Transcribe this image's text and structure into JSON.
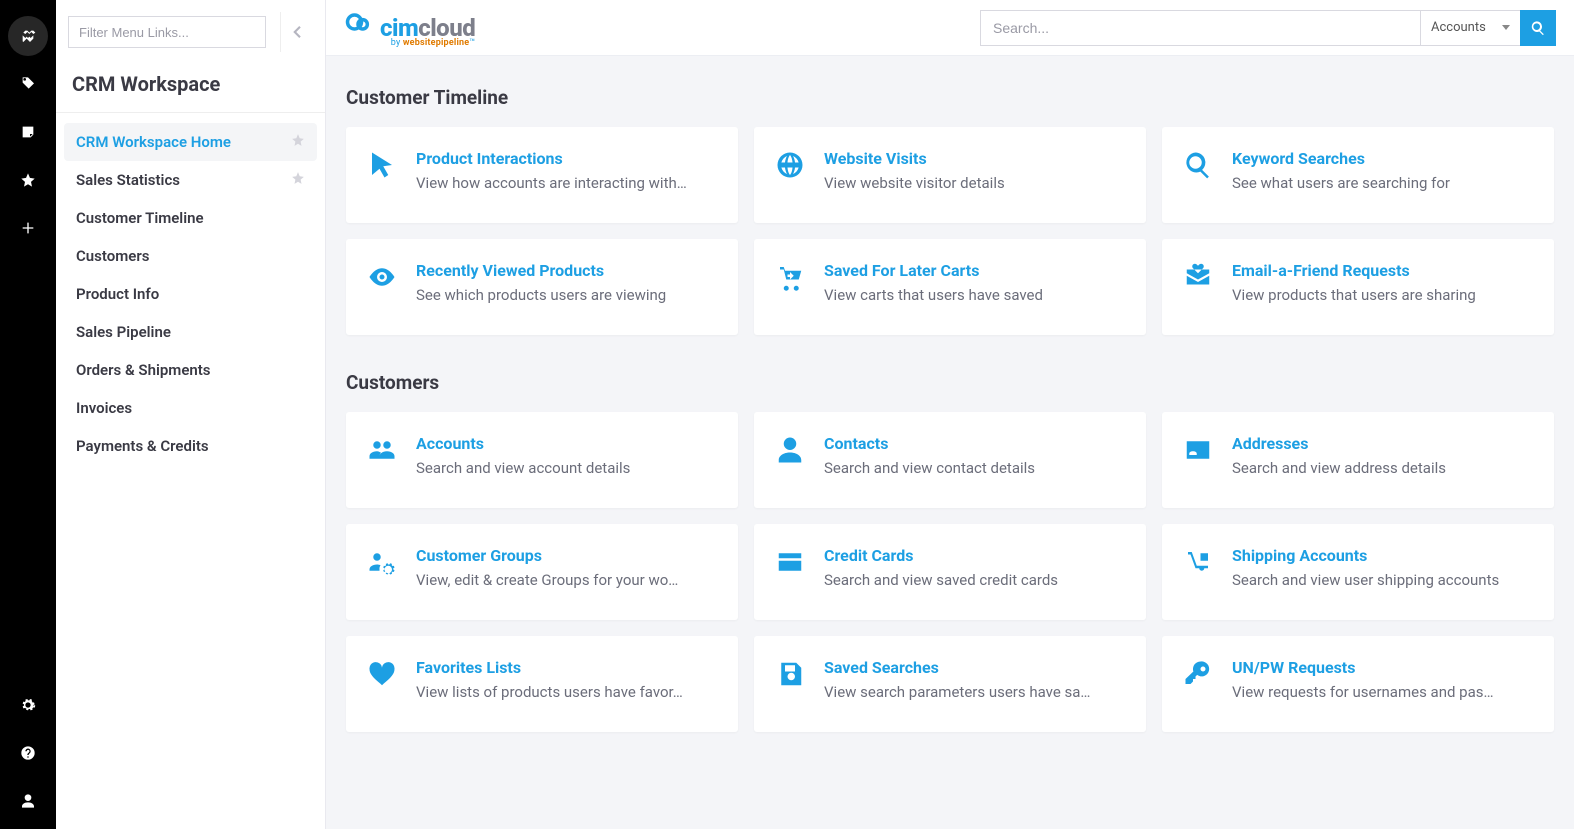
{
  "rail": {
    "items": [
      {
        "name": "handshake-icon",
        "active": true
      },
      {
        "name": "tag-icon"
      },
      {
        "name": "note-icon"
      },
      {
        "name": "star-icon"
      },
      {
        "name": "plus-icon"
      }
    ],
    "bottom": [
      {
        "name": "gear-icon"
      },
      {
        "name": "help-icon"
      },
      {
        "name": "user-icon"
      }
    ]
  },
  "sidebar": {
    "filter_placeholder": "Filter Menu Links...",
    "title": "CRM Workspace",
    "items": [
      {
        "label": "CRM Workspace Home",
        "active": true,
        "starred": false,
        "show_star": true
      },
      {
        "label": "Sales Statistics",
        "starred": false,
        "show_star": true
      },
      {
        "label": "Customer Timeline"
      },
      {
        "label": "Customers"
      },
      {
        "label": "Product Info"
      },
      {
        "label": "Sales Pipeline"
      },
      {
        "label": "Orders & Shipments"
      },
      {
        "label": "Invoices"
      },
      {
        "label": "Payments & Credits"
      }
    ]
  },
  "topbar": {
    "logo_main_1": "cim",
    "logo_main_2": "cloud",
    "logo_sub_prefix": "by ",
    "logo_sub_brand": "websitepipeline",
    "search_placeholder": "Search...",
    "search_scope": "Accounts"
  },
  "sections": [
    {
      "title": "Customer Timeline",
      "cards": [
        {
          "icon": "cursor-icon",
          "title": "Product Interactions",
          "desc": "View how accounts are interacting with…"
        },
        {
          "icon": "globe-icon",
          "title": "Website Visits",
          "desc": "View website visitor details"
        },
        {
          "icon": "search-icon",
          "title": "Keyword Searches",
          "desc": "See what users are searching for"
        },
        {
          "icon": "eye-icon",
          "title": "Recently Viewed Products",
          "desc": "See which products users are viewing"
        },
        {
          "icon": "cart-down-icon",
          "title": "Saved For Later Carts",
          "desc": "View carts that users have saved"
        },
        {
          "icon": "mail-heart-icon",
          "title": "Email-a-Friend Requests",
          "desc": "View products that users are sharing"
        }
      ]
    },
    {
      "title": "Customers",
      "cards": [
        {
          "icon": "users-icon",
          "title": "Accounts",
          "desc": "Search and view account details"
        },
        {
          "icon": "user-solid-icon",
          "title": "Contacts",
          "desc": "Search and view contact details"
        },
        {
          "icon": "id-card-icon",
          "title": "Addresses",
          "desc": "Search and view address details"
        },
        {
          "icon": "users-cog-icon",
          "title": "Customer Groups",
          "desc": "View, edit & create Groups for your wo…"
        },
        {
          "icon": "credit-card-icon",
          "title": "Credit Cards",
          "desc": "Search and view saved credit cards"
        },
        {
          "icon": "dolly-icon",
          "title": "Shipping Accounts",
          "desc": "Search and view user shipping accounts"
        },
        {
          "icon": "heart-icon",
          "title": "Favorites Lists",
          "desc": "View lists of products users have favor…"
        },
        {
          "icon": "save-icon",
          "title": "Saved Searches",
          "desc": "View search parameters users have sa…"
        },
        {
          "icon": "key-icon",
          "title": "UN/PW Requests",
          "desc": "View requests for usernames and pas…"
        }
      ]
    }
  ]
}
